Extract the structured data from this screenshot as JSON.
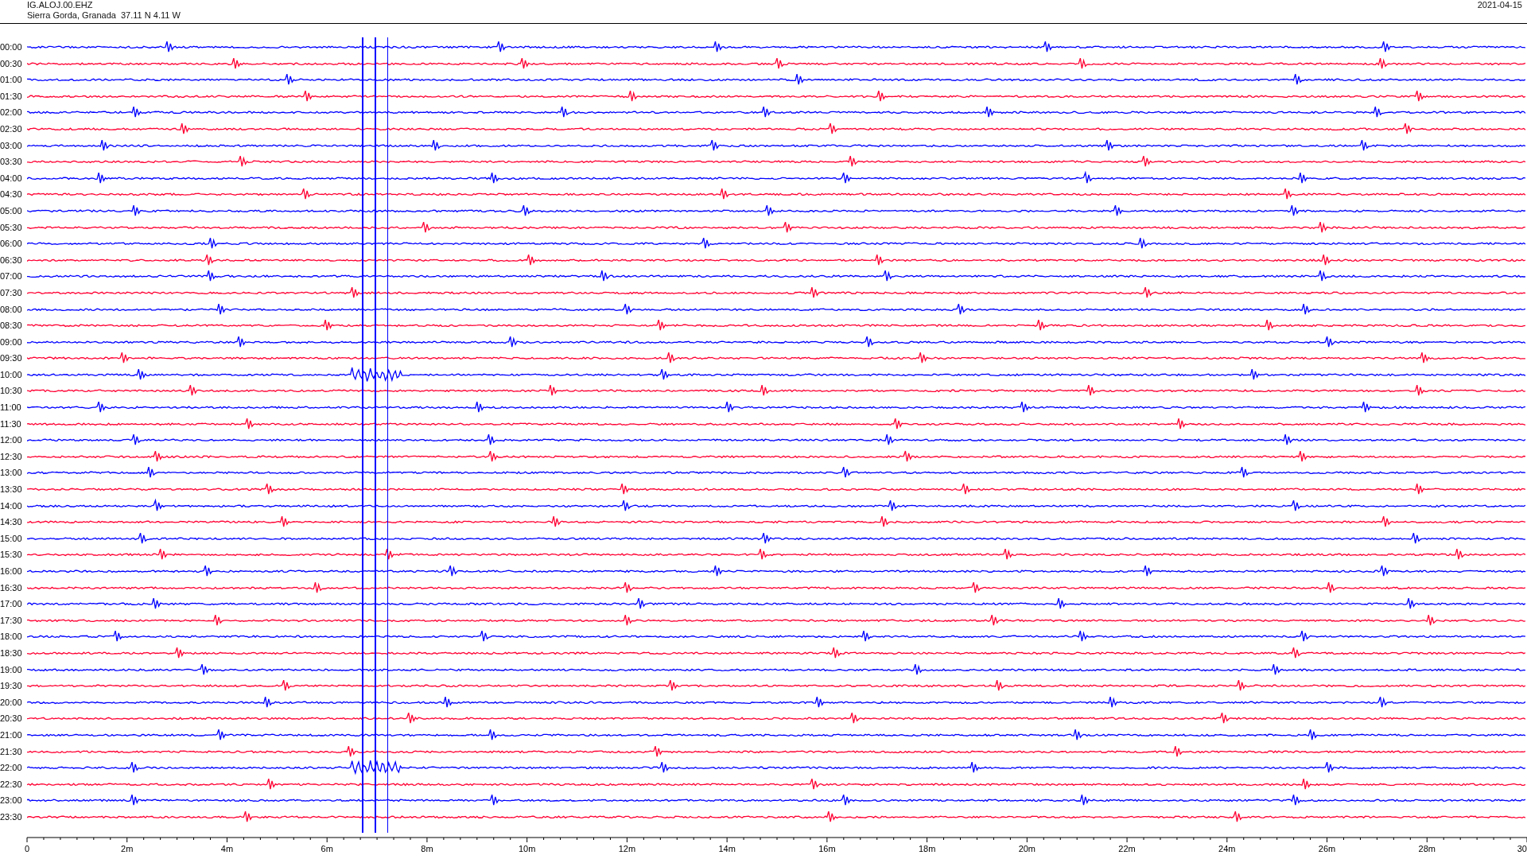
{
  "header": {
    "station": "IG.ALOJ.00.EHZ",
    "location": "Sierra Gorda, Granada  37.11 N 4.11 W",
    "date": "2021-04-15"
  },
  "rows": [
    {
      "time": "00:00",
      "color": "#0000ff"
    },
    {
      "time": "00:30",
      "color": "#ff0033"
    },
    {
      "time": "01:00",
      "color": "#0000ff"
    },
    {
      "time": "01:30",
      "color": "#ff0033"
    },
    {
      "time": "02:00",
      "color": "#0000ff"
    },
    {
      "time": "02:30",
      "color": "#ff0033"
    },
    {
      "time": "03:00",
      "color": "#0000ff"
    },
    {
      "time": "03:30",
      "color": "#ff0033"
    },
    {
      "time": "04:00",
      "color": "#0000ff"
    },
    {
      "time": "04:30",
      "color": "#ff0033"
    },
    {
      "time": "05:00",
      "color": "#0000ff"
    },
    {
      "time": "05:30",
      "color": "#ff0033"
    },
    {
      "time": "06:00",
      "color": "#0000ff"
    },
    {
      "time": "06:30",
      "color": "#ff0033"
    },
    {
      "time": "07:00",
      "color": "#0000ff"
    },
    {
      "time": "07:30",
      "color": "#ff0033"
    },
    {
      "time": "08:00",
      "color": "#0000ff"
    },
    {
      "time": "08:30",
      "color": "#ff0033"
    },
    {
      "time": "09:00",
      "color": "#0000ff"
    },
    {
      "time": "09:30",
      "color": "#ff0033"
    },
    {
      "time": "10:00",
      "color": "#0000ff"
    },
    {
      "time": "10:30",
      "color": "#ff0033"
    },
    {
      "time": "11:00",
      "color": "#0000ff"
    },
    {
      "time": "11:30",
      "color": "#ff0033"
    },
    {
      "time": "12:00",
      "color": "#0000ff"
    },
    {
      "time": "12:30",
      "color": "#ff0033"
    },
    {
      "time": "13:00",
      "color": "#0000ff"
    },
    {
      "time": "13:30",
      "color": "#ff0033"
    },
    {
      "time": "14:00",
      "color": "#0000ff"
    },
    {
      "time": "14:30",
      "color": "#ff0033"
    },
    {
      "time": "15:00",
      "color": "#0000ff"
    },
    {
      "time": "15:30",
      "color": "#ff0033"
    },
    {
      "time": "16:00",
      "color": "#0000ff"
    },
    {
      "time": "16:30",
      "color": "#ff0033"
    },
    {
      "time": "17:00",
      "color": "#0000ff"
    },
    {
      "time": "17:30",
      "color": "#ff0033"
    },
    {
      "time": "18:00",
      "color": "#0000ff"
    },
    {
      "time": "18:30",
      "color": "#ff0033"
    },
    {
      "time": "19:00",
      "color": "#0000ff"
    },
    {
      "time": "19:30",
      "color": "#ff0033"
    },
    {
      "time": "20:00",
      "color": "#0000ff"
    },
    {
      "time": "20:30",
      "color": "#ff0033"
    },
    {
      "time": "21:00",
      "color": "#0000ff"
    },
    {
      "time": "21:30",
      "color": "#ff0033"
    },
    {
      "time": "22:00",
      "color": "#0000ff"
    },
    {
      "time": "22:30",
      "color": "#ff0033"
    },
    {
      "time": "23:00",
      "color": "#0000ff"
    },
    {
      "time": "23:30",
      "color": "#ff0033"
    }
  ],
  "x_axis": {
    "labels": [
      "0",
      "2m",
      "4m",
      "6m",
      "8m",
      "10m",
      "12m",
      "14m",
      "16m",
      "18m",
      "20m",
      "22m",
      "24m",
      "26m",
      "28m",
      "30"
    ]
  }
}
